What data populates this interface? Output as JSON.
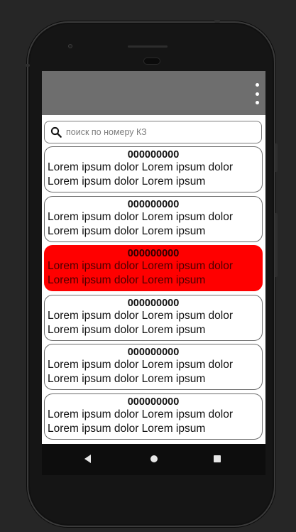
{
  "appbar": {
    "menu_icon": "more-vert-icon"
  },
  "search": {
    "placeholder": "поиск по номеру КЗ",
    "value": "",
    "icon": "search-icon"
  },
  "items": [
    {
      "number": "000000000",
      "text": "Lorem ipsum dolor Lorem ipsum dolor\nLorem ipsum dolor Lorem ipsum",
      "selected": false
    },
    {
      "number": "000000000",
      "text": "Lorem ipsum dolor Lorem ipsum dolor\nLorem ipsum dolor Lorem ipsum",
      "selected": false
    },
    {
      "number": "000000000",
      "text": "Lorem ipsum dolor Lorem ipsum dolor\nLorem ipsum dolor Lorem ipsum",
      "selected": true
    },
    {
      "number": "000000000",
      "text": "Lorem ipsum dolor Lorem ipsum dolor\nLorem ipsum dolor Lorem ipsum",
      "selected": false
    },
    {
      "number": "000000000",
      "text": "Lorem ipsum dolor Lorem ipsum dolor\nLorem ipsum dolor Lorem ipsum",
      "selected": false
    },
    {
      "number": "000000000",
      "text": "Lorem ipsum dolor Lorem ipsum dolor\nLorem ipsum dolor Lorem ipsum",
      "selected": false
    }
  ],
  "navbar": {
    "back": "back-icon",
    "home": "home-icon",
    "recents": "recents-icon"
  },
  "colors": {
    "appbar": "#6e6e6e",
    "selected": "#ff0000",
    "background": "#262626"
  }
}
